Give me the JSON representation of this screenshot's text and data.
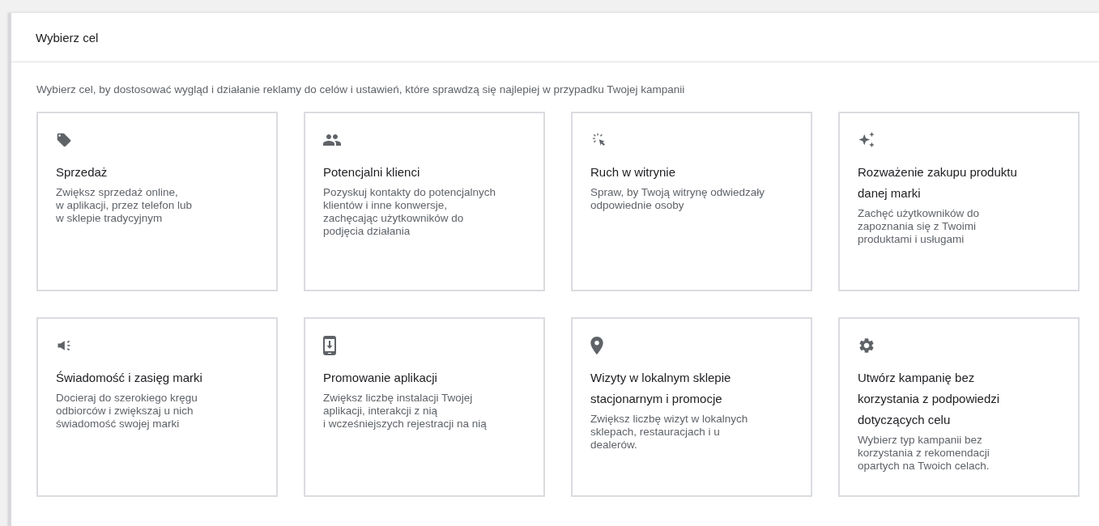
{
  "panel": {
    "title": "Wybierz cel",
    "intro": "Wybierz cel, by dostosować wygląd i działanie reklamy do celów i ustawień, które sprawdzą się najlepiej w przypadku Twojej kampanii"
  },
  "goals": [
    {
      "kind": "tag",
      "title_lines": [
        "Sprzedaż"
      ],
      "description_lines": [
        "Zwiększ sprzedaż online,",
        "w aplikacji, przez telefon lub",
        "w sklepie tradycyjnym"
      ]
    },
    {
      "kind": "people",
      "title_lines": [
        "Potencjalni klienci"
      ],
      "description_lines": [
        "Pozyskuj kontakty do potencjalnych",
        "klientów i inne konwersje,",
        "zachęcając użytkowników do",
        "podjęcia działania"
      ]
    },
    {
      "kind": "click",
      "title_lines": [
        "Ruch w witrynie"
      ],
      "description_lines": [
        "Spraw, by Twoją witrynę odwiedzały",
        "odpowiednie osoby"
      ]
    },
    {
      "kind": "sparkle",
      "title_lines": [
        "Rozważenie zakupu produktu",
        "danej marki"
      ],
      "description_lines": [
        "Zachęć użytkowników do",
        "zapoznania się z Twoimi",
        "produktami i usługami"
      ]
    },
    {
      "kind": "speaker",
      "title_lines": [
        "Świadomość i zasięg marki"
      ],
      "description_lines": [
        "Docieraj do szerokiego kręgu",
        "odbiorców i zwiększaj u nich",
        "świadomość swojej marki"
      ]
    },
    {
      "kind": "phone",
      "title_lines": [
        "Promowanie aplikacji"
      ],
      "description_lines": [
        "Zwiększ liczbę instalacji Twojej",
        "aplikacji, interakcji z nią",
        "i wcześniejszych rejestracji na nią"
      ]
    },
    {
      "kind": "pin",
      "title_lines": [
        "Wizyty w lokalnym sklepie",
        "stacjonarnym i promocje"
      ],
      "description_lines": [
        "Zwiększ liczbę wizyt w lokalnych",
        "sklepach, restauracjach i u",
        "dealerów."
      ]
    },
    {
      "kind": "gear",
      "title_lines": [
        "Utwórz kampanię bez",
        "korzystania z podpowiedzi",
        "dotyczących celu"
      ],
      "description_lines": [
        "Wybierz typ kampanii bez",
        "korzystania z rekomendacji",
        "opartych na Twoich celach."
      ]
    }
  ]
}
